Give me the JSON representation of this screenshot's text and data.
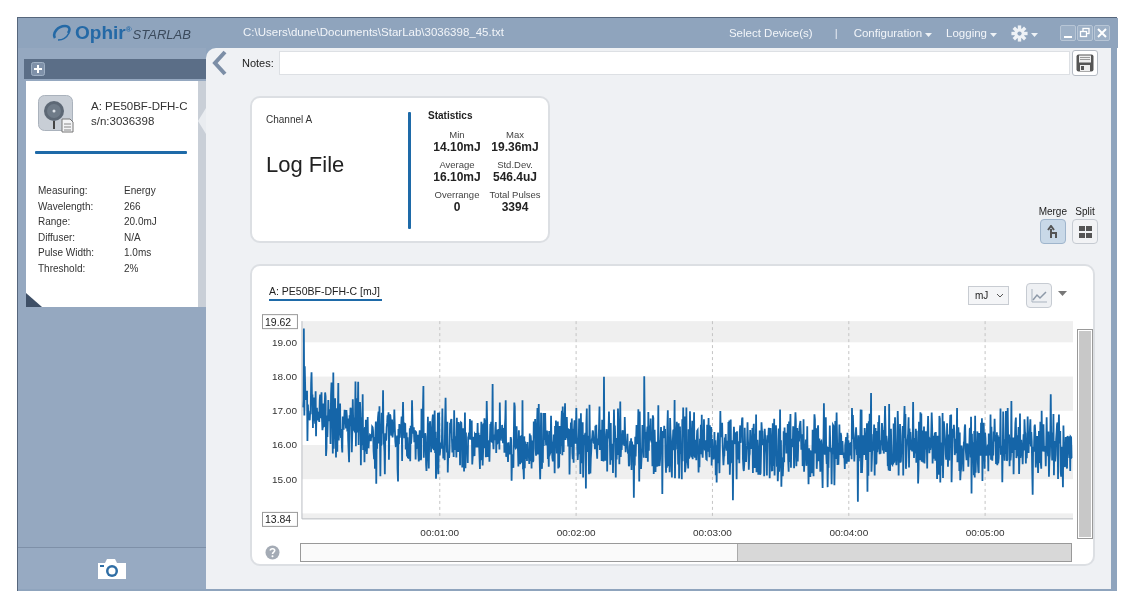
{
  "window": {
    "logo_brand": "Ophir$^{®}$",
    "logo_product": "STARLAB",
    "file_path": "C:\\Users\\dune\\Documents\\StarLab\\3036398_45.txt"
  },
  "menu": [
    {
      "label": "Select Device(s)",
      "kind": "link"
    },
    {
      "label": "|",
      "kind": "separator"
    },
    {
      "label": "Configuration",
      "kind": "dropdown"
    },
    {
      "label": "Logging",
      "kind": "dropdown"
    }
  ],
  "sidebar": {
    "device_name": "A: PE50BF-DFH-C",
    "serial": "s/n:3036398",
    "properties": [
      {
        "label": "Measuring:",
        "value": "Energy"
      },
      {
        "label": "Wavelength:",
        "value": "266"
      },
      {
        "label": "Range:",
        "value": "20.0mJ"
      },
      {
        "label": "Diffuser:",
        "value": "N/A"
      },
      {
        "label": "Pulse Width:",
        "value": "1.0ms"
      },
      {
        "label": "Threshold:",
        "value": "2%"
      }
    ]
  },
  "notes": {
    "label": "Notes:"
  },
  "channel_card": {
    "channel": "Channel A",
    "mode": "Log File",
    "statistics_title": "Statistics",
    "stats": [
      {
        "label": "Min",
        "value": "14.10mJ"
      },
      {
        "label": "Max",
        "value": "19.36mJ"
      },
      {
        "label": "Average",
        "value": "16.10mJ"
      },
      {
        "label": "Std.Dev.",
        "value": "546.4uJ"
      },
      {
        "label": "Overrange",
        "value": "0"
      },
      {
        "label": "Total Pulses",
        "value": "3394"
      }
    ]
  },
  "view_buttons": [
    {
      "label": "Merge",
      "kind": "merge",
      "selected": true
    },
    {
      "label": "Split",
      "kind": "split",
      "selected": false
    }
  ],
  "chart": {
    "title": "A: PE50BF-DFH-C [mJ]",
    "unit": "mJ",
    "y_max": "19.62",
    "y_min": "13.84",
    "y_ticks": [
      "19.00",
      "18.00",
      "17.00",
      "16.00",
      "15.00"
    ],
    "x_ticks": [
      "00:01:00",
      "00:02:00",
      "00:03:00",
      "00:04:00",
      "00:05:00"
    ]
  }
}
